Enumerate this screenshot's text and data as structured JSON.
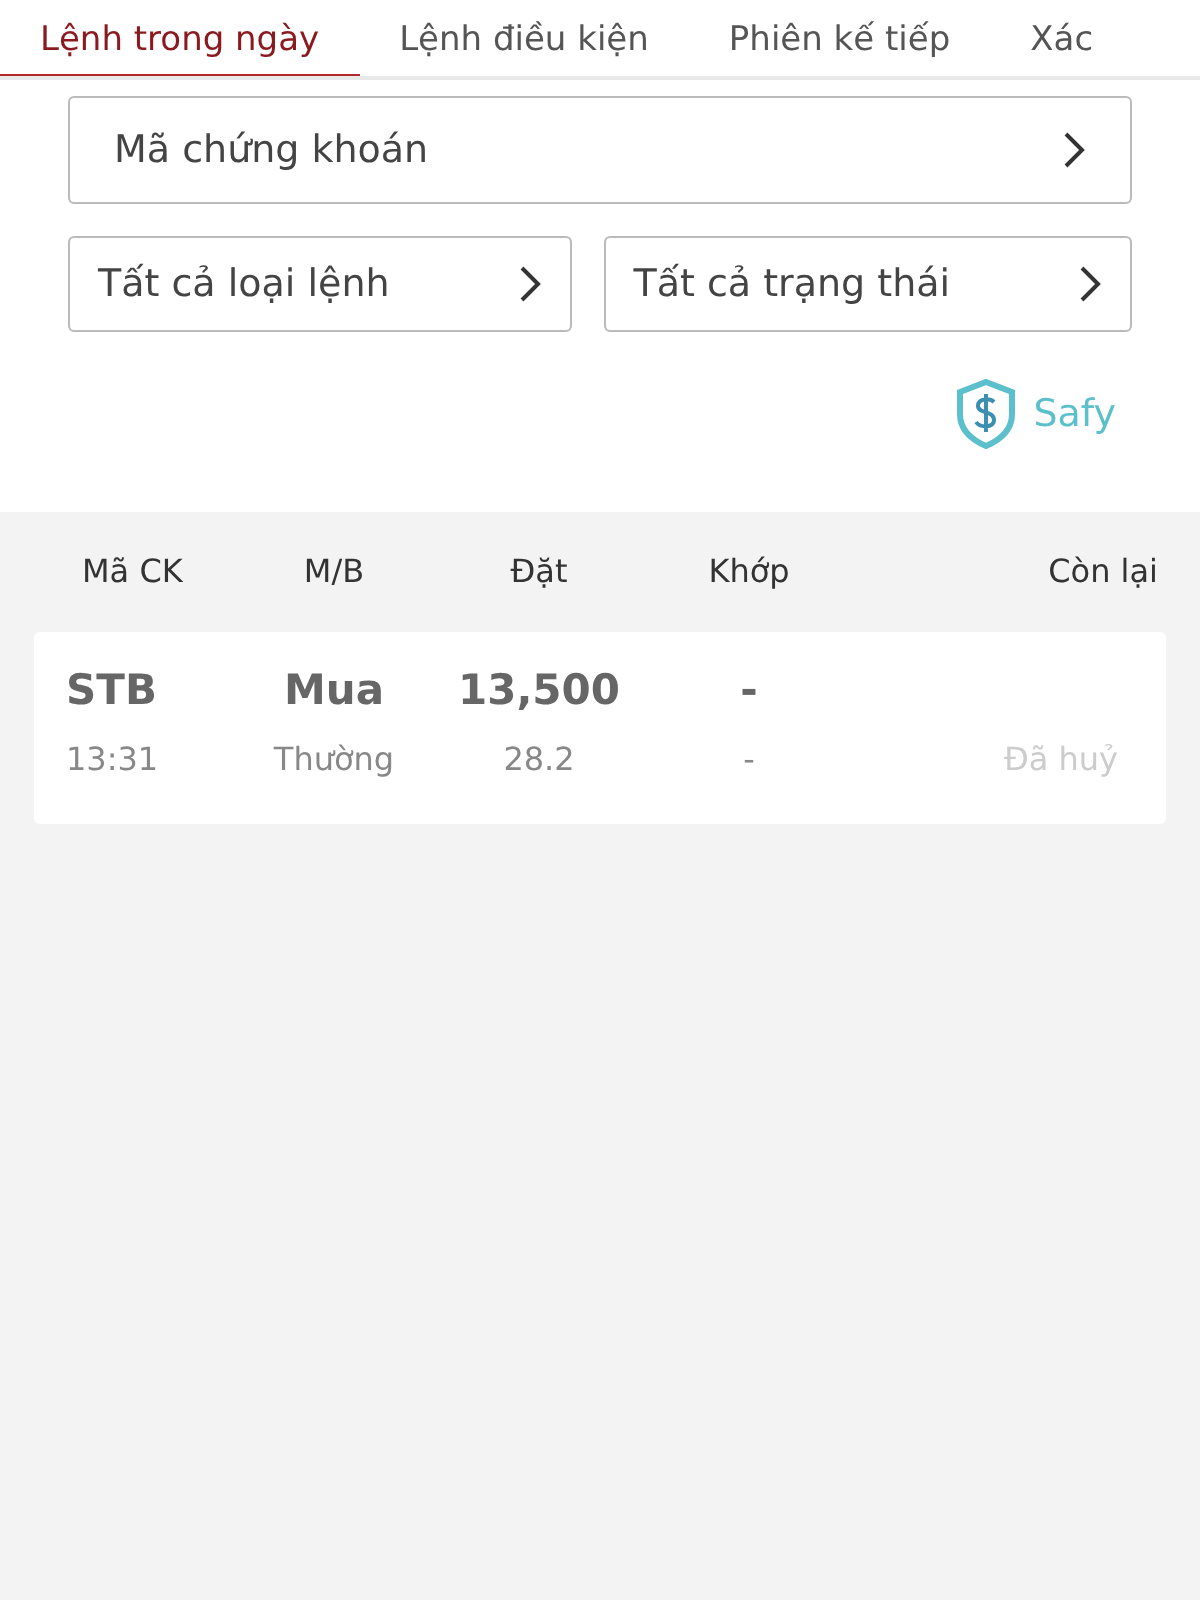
{
  "tabs": [
    {
      "label": "Lệnh trong ngày",
      "selected": true
    },
    {
      "label": "Lệnh điều kiện",
      "selected": false
    },
    {
      "label": "Phiên kế tiếp",
      "selected": false
    },
    {
      "label": "Xác",
      "selected": false
    }
  ],
  "filters": {
    "symbol": {
      "placeholder": "Mã chứng khoán"
    },
    "order_type": "Tất cả loại lệnh",
    "status": "Tất cả trạng thái"
  },
  "safy": {
    "label": "Safy"
  },
  "table": {
    "columns": [
      "Mã CK",
      "M/B",
      "Đặt",
      "Khớp",
      "Còn lại"
    ],
    "rows": [
      {
        "symbol": "STB",
        "side": "Mua",
        "price": "13,500",
        "matched": "-",
        "time": "13:31",
        "order_type": "Thường",
        "quantity": "28.2",
        "matched_qty": "-",
        "status": "Đã huỷ"
      }
    ]
  }
}
